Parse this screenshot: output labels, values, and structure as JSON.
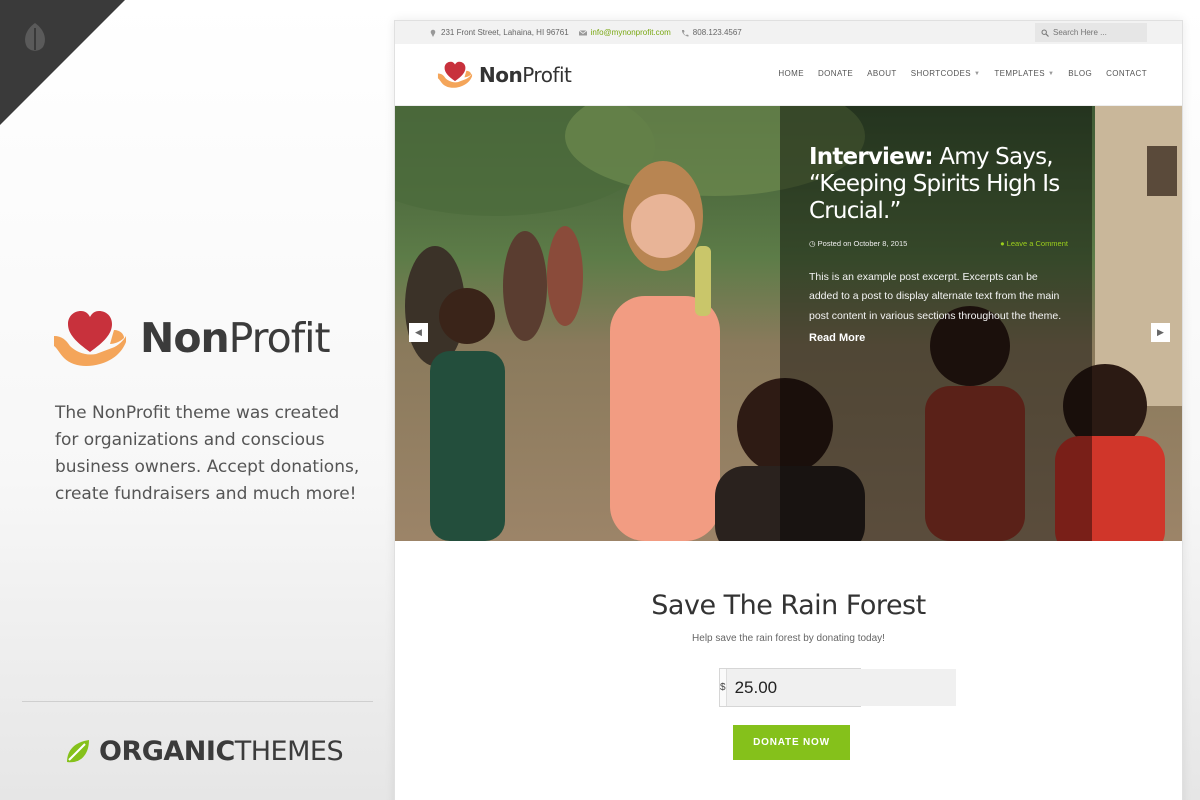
{
  "colors": {
    "accent_green": "#85c11b",
    "logo_heart": "#c8313c",
    "logo_hand": "#f4a55a",
    "corner_dark": "#3a3a3a"
  },
  "promo": {
    "logo": {
      "bold": "Non",
      "light": "Profit",
      "icon": "heart-hand-icon"
    },
    "description": "The NonProfit theme was created for organizations and conscious business owners. Accept donations, create fundraisers and much more!",
    "brand": {
      "bold": "ORGANIC",
      "light": "THEMES",
      "icon": "leaf-icon"
    }
  },
  "site": {
    "topbar": {
      "address": "231 Front Street, Lahaina, HI 96761",
      "email": "info@mynonprofit.com",
      "phone": "808.123.4567",
      "search_placeholder": "Search Here ..."
    },
    "logo": {
      "bold": "Non",
      "light": "Profit"
    },
    "nav": {
      "items": [
        {
          "label": "HOME"
        },
        {
          "label": "DONATE"
        },
        {
          "label": "ABOUT"
        },
        {
          "label": "SHORTCODES"
        },
        {
          "label": "TEMPLATES"
        },
        {
          "label": "BLOG"
        },
        {
          "label": "CONTACT"
        }
      ]
    },
    "slide": {
      "title_bold": "Interview:",
      "title_rest": " Amy Says, “Keeping Spirits High Is Crucial.”",
      "posted": "Posted on October 8, 2015",
      "comment_link": "Leave a Comment",
      "excerpt": "This is an example post excerpt. Excerpts can be added to a post to display alternate text from the main post content in various sections throughout the theme.",
      "read_more": "Read More"
    },
    "donate": {
      "title": "Save The Rain Forest",
      "subtitle": "Help save the rain forest by donating today!",
      "currency": "$",
      "amount": "25.00",
      "button": "DONATE NOW"
    }
  }
}
